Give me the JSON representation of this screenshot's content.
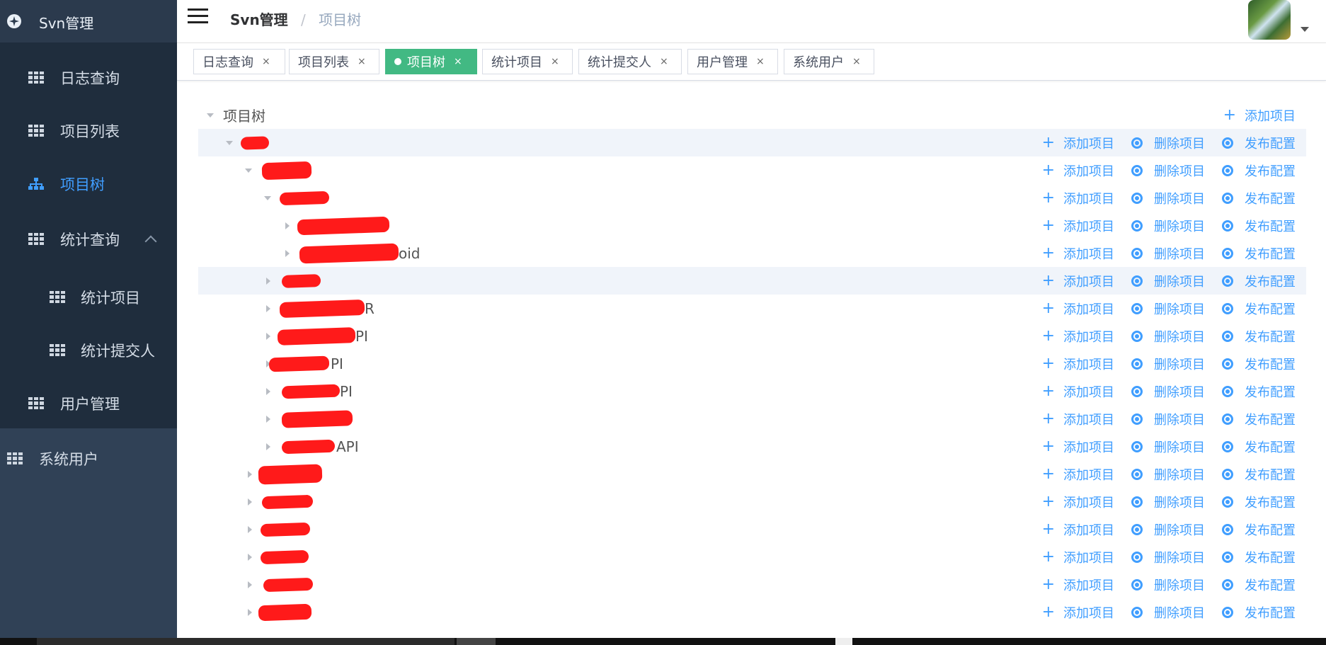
{
  "sidebar": {
    "app_title": "Svn管理",
    "items": [
      {
        "label": "日志查询",
        "icon": "table-icon"
      },
      {
        "label": "项目列表",
        "icon": "table-icon"
      },
      {
        "label": "项目树",
        "icon": "tree-icon",
        "active": true
      },
      {
        "label": "统计查询",
        "icon": "table-icon"
      },
      {
        "label": "统计项目",
        "icon": "table-icon"
      },
      {
        "label": "统计提交人",
        "icon": "table-icon"
      },
      {
        "label": "用户管理",
        "icon": "table-icon"
      },
      {
        "label": "系统用户",
        "icon": "table-icon"
      }
    ]
  },
  "header": {
    "breadcrumb_root": "Svn管理",
    "breadcrumb_sep": "/",
    "breadcrumb_current": "项目树"
  },
  "tags": [
    {
      "label": "日志查询"
    },
    {
      "label": "项目列表"
    },
    {
      "label": "项目树",
      "active": true
    },
    {
      "label": "统计项目"
    },
    {
      "label": "统计提交人"
    },
    {
      "label": "用户管理"
    },
    {
      "label": "系统用户"
    }
  ],
  "tag_close": "×",
  "tree": {
    "root_label": "项目树",
    "add_label": "添加项目",
    "delete_label": "删除项目",
    "publish_label": "发布配置",
    "visible_fragments": [
      "oid",
      "R",
      "PI",
      "PI",
      "PI",
      "API"
    ]
  },
  "colors": {
    "sidebar_bg": "#304156",
    "sidebar_active": "#409eff",
    "tag_active": "#42b983",
    "action_link": "#409eff"
  }
}
